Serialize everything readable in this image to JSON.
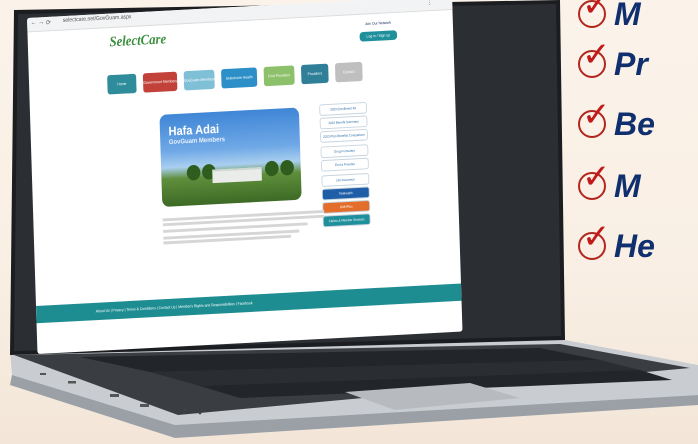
{
  "checklist": {
    "items": [
      {
        "text": "M"
      },
      {
        "text": "Pr"
      },
      {
        "text": "Be"
      },
      {
        "text": "M"
      },
      {
        "text": "He"
      }
    ],
    "check_color": "#c2191b",
    "text_color": "#0f2f6e"
  },
  "browser": {
    "url": "selectcare.net/GovGuam.aspx"
  },
  "website": {
    "logo": "SelectCare",
    "header_link": "Join Our Network",
    "header_button": "Log in / Sign up",
    "tiles": [
      {
        "label": "Home",
        "color": "#2f8d9b"
      },
      {
        "label": "Government Members",
        "color": "#c2423a"
      },
      {
        "label": "GovGuam Members",
        "color": "#7fc0d6"
      },
      {
        "label": "Selectcare Health Members",
        "color": "#2c8fc8"
      },
      {
        "label": "Find Providers",
        "color": "#8cc06a"
      },
      {
        "label": "Providers",
        "color": "#2f7f98"
      },
      {
        "label": "Contact",
        "color": "#bfbfbf"
      }
    ],
    "hero": {
      "title": "Hafa Adai",
      "subtitle": "GovGuam Members"
    },
    "side_links": [
      "2023 Enrollment Kit",
      "2023 Benefit Summary",
      "2023 Plan Benefits Comparison",
      "Drug Formulary",
      "Find a Provider",
      "Life Insurance",
      "Telehealth",
      "GMHPlus",
      "Claims & Member Services"
    ],
    "footer_links": "About Us  |  Privacy  |  Terms & Conditions  |  Contact Us  |  Member's Rights and Responsibilities  |  Facebook"
  }
}
